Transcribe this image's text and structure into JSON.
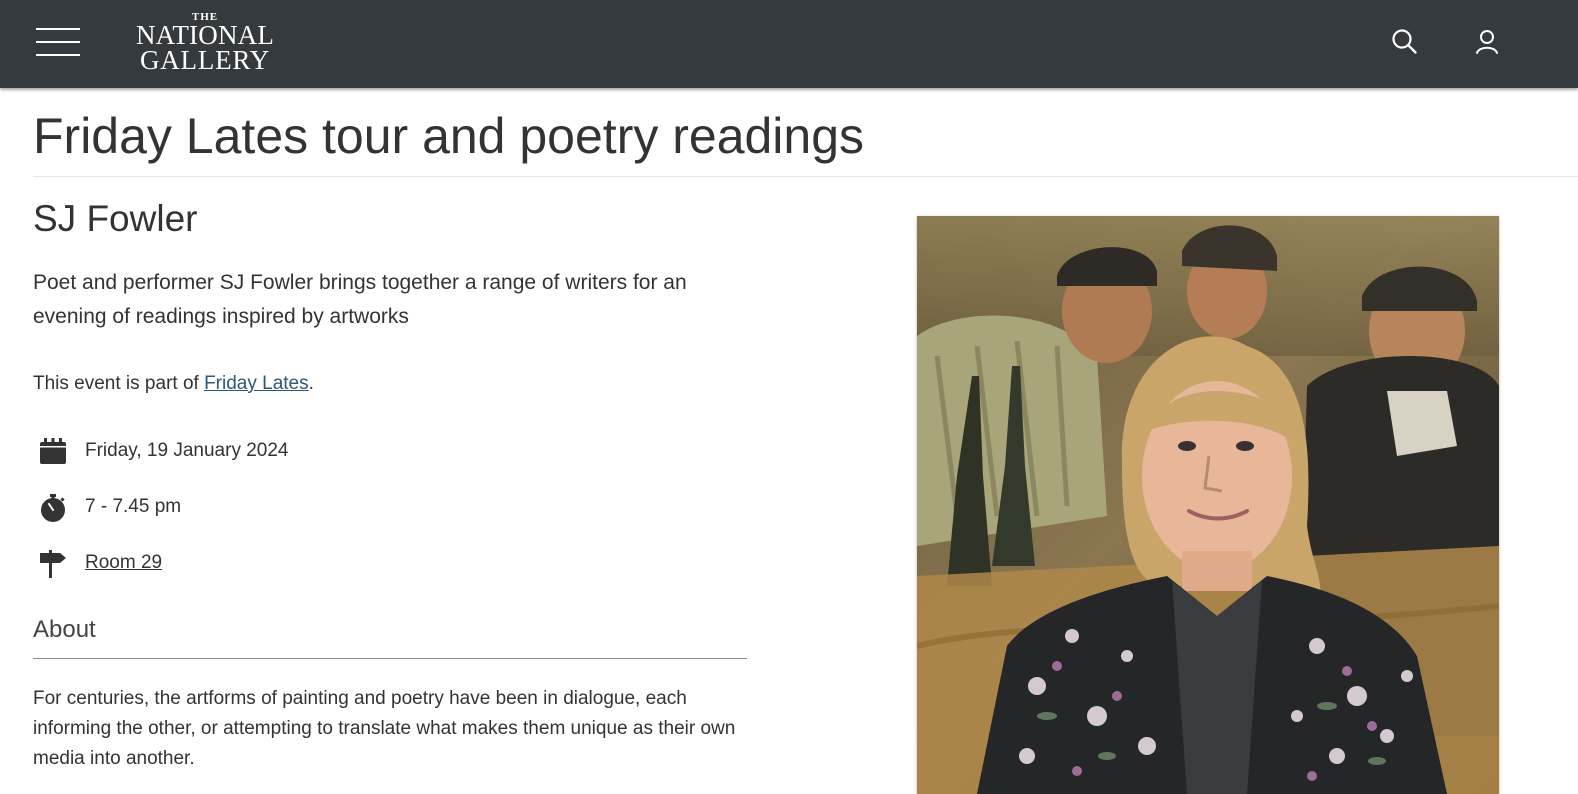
{
  "header": {
    "logo": {
      "line1": "THE",
      "line2": "NATIONAL",
      "line3": "GALLERY"
    },
    "menu_icon": "hamburger-menu-icon",
    "search_icon": "search-icon",
    "account_icon": "user-account-icon",
    "background": "#353a3e"
  },
  "page": {
    "title": "Friday Lates tour and poetry readings"
  },
  "event": {
    "subtitle": "SJ Fowler",
    "intro": "Poet and performer SJ Fowler brings together a range of writers for an evening of readings inspired by artworks",
    "part_of_prefix": "This event is part of ",
    "part_of_link": "Friday Lates",
    "part_of_suffix": ".",
    "date": {
      "icon": "calendar-icon",
      "text": "Friday, 19 January 2024"
    },
    "time": {
      "icon": "stopwatch-icon",
      "text": "7 - 7.45 pm"
    },
    "location": {
      "icon": "signpost-icon",
      "text": "Room 29"
    }
  },
  "about": {
    "heading": "About",
    "text": "For centuries, the artforms of painting and poetry have been in dialogue, each informing the other, or attempting to translate what makes them unique as their own media into another."
  },
  "hero_image": {
    "icon": "portrait-photo",
    "link_color": "#2a5878"
  }
}
